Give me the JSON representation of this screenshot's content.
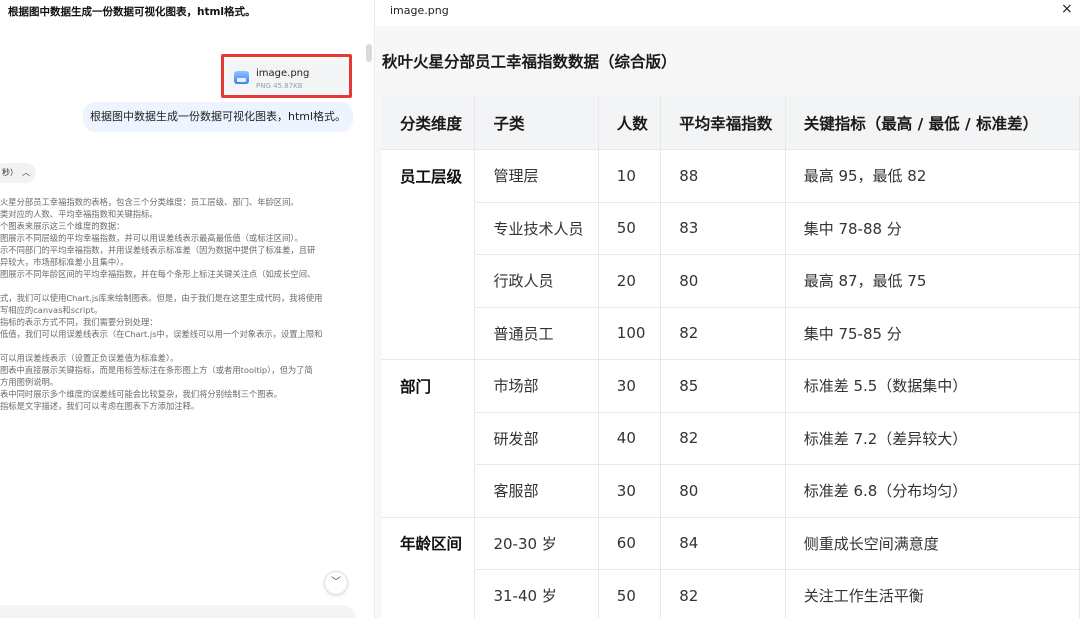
{
  "chat": {
    "top_prompt": "根据图中数据生成一份数据可视化图表，html格式。",
    "attachment": {
      "name": "image.png",
      "meta": "PNG 45.87KB"
    },
    "user_message": "根据图中数据生成一份数据可视化图表，html格式。",
    "thinking_label": "秒）",
    "reasoning_lines": [
      "火星分部员工幸福指数的表格，包含三个分类维度：员工层级、部门、年龄区间。",
      "类对应的人数、平均幸福指数和关键指标。",
      "个图表来展示这三个维度的数据：",
      "图展示不同层级的平均幸福指数，并可以用误差线表示最高最低值（或标注区间）。",
      "示不同部门的平均幸福指数，并用误差线表示标准差（因为数据中提供了标准差，且研",
      "异较大，市场部标准差小且集中）。",
      "图展示不同年龄区间的平均幸福指数，并在每个条形上标注关键关注点（如成长空间、",
      "",
      "式，我们可以使用Chart.js库来绘制图表。但是，由于我们是在这里生成代码，我将使用",
      "写相应的canvas和script。",
      "指标的表示方式不同，我们需要分别处理：",
      "低值，我们可以用误差线表示（在Chart.js中，误差线可以用一个对象表示，设置上限和",
      "",
      "可以用误差线表示（设置正负误差值为标准差）。",
      "图表中直接展示关键指标，而是用标签标注在条形图上方（或者用tooltip），但为了简",
      "方用图例说明。",
      "表中同时展示多个维度的误差线可能会比较复杂，我们将分别绘制三个图表。",
      "指标是文字描述，我们可以考虑在图表下方添加注释。"
    ]
  },
  "preview": {
    "filename": "image.png",
    "close_glyph": "×",
    "title": "秋叶火星分部员工幸福指数数据（综合版）",
    "columns": [
      "分类维度",
      "子类",
      "人数",
      "平均幸福指数",
      "关键指标（最高 / 最低 / 标准差）"
    ],
    "rows": [
      {
        "category": "员工层级",
        "sub": "管理层",
        "count": "10",
        "avg": "88",
        "key": "最高 95，最低 82"
      },
      {
        "category": "",
        "sub": "专业技术人员",
        "count": "50",
        "avg": "83",
        "key": "集中 78-88 分"
      },
      {
        "category": "",
        "sub": "行政人员",
        "count": "20",
        "avg": "80",
        "key": "最高 87，最低 75"
      },
      {
        "category": "",
        "sub": "普通员工",
        "count": "100",
        "avg": "82",
        "key": "集中 75-85 分"
      },
      {
        "category": "部门",
        "sub": "市场部",
        "count": "30",
        "avg": "85",
        "key": "标准差 5.5（数据集中）"
      },
      {
        "category": "",
        "sub": "研发部",
        "count": "40",
        "avg": "82",
        "key": "标准差 7.2（差异较大）"
      },
      {
        "category": "",
        "sub": "客服部",
        "count": "30",
        "avg": "80",
        "key": "标准差 6.8（分布均匀）"
      },
      {
        "category": "年龄区间",
        "sub": "20-30 岁",
        "count": "60",
        "avg": "84",
        "key": "侧重成长空间满意度"
      },
      {
        "category": "",
        "sub": "31-40 岁",
        "count": "50",
        "avg": "82",
        "key": "关注工作生活平衡"
      }
    ]
  },
  "colors": {
    "highlight_border": "#e53935",
    "bubble_bg": "#eef4ff",
    "header_bg": "#f3f4f6"
  }
}
